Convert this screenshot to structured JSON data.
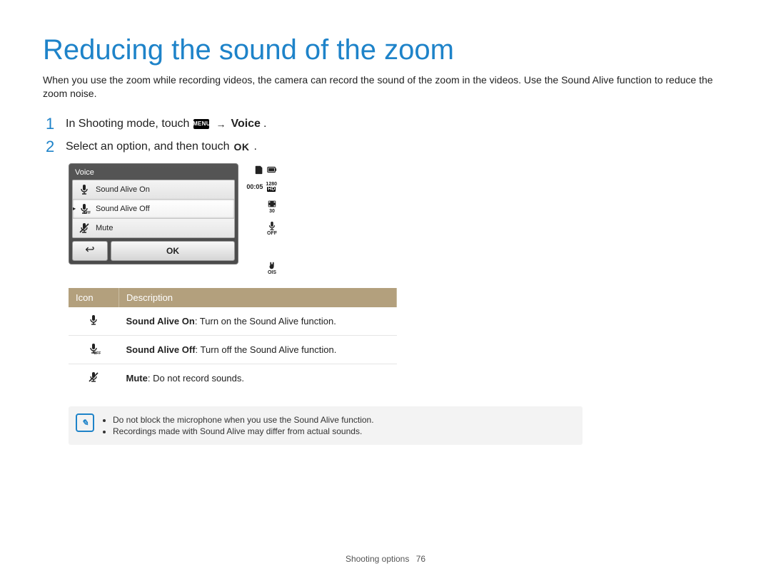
{
  "title": "Reducing the sound of the zoom",
  "intro": "When you use the zoom while recording videos, the camera can record the sound of the zoom in the videos. Use the Sound Alive function to reduce the zoom noise.",
  "steps": {
    "s1_num": "1",
    "s1_a": "In Shooting mode, touch ",
    "s1_menu_label": "MENU",
    "s1_arrow": "→",
    "s1_bold": "Voice",
    "s1_period": ".",
    "s2_num": "2",
    "s2_a": "Select an option, and then touch ",
    "s2_ok": "OK",
    "s2_period": "."
  },
  "screen": {
    "title": "Voice",
    "items": [
      {
        "label": "Sound Alive On"
      },
      {
        "label": "Sound Alive Off"
      },
      {
        "label": "Mute"
      }
    ],
    "back_symbol": "↩",
    "ok_label": "OK",
    "side": {
      "time": "00:05",
      "res_top": "1280",
      "res_bottom": "HD",
      "fps": "30",
      "off": "OFF",
      "ois": "OIS"
    }
  },
  "table": {
    "hdr_icon": "Icon",
    "hdr_desc": "Description",
    "rows": [
      {
        "label": "Sound Alive On",
        "desc": ": Turn on the Sound Alive function."
      },
      {
        "label": "Sound Alive Off",
        "desc": ": Turn off the Sound Alive function."
      },
      {
        "label": "Mute",
        "desc": ": Do not record sounds."
      }
    ]
  },
  "note": {
    "bullets": [
      "Do not block the microphone when you use the Sound Alive function.",
      "Recordings made with Sound Alive may differ from actual sounds."
    ]
  },
  "footer": {
    "section": "Shooting options",
    "page": "76"
  }
}
